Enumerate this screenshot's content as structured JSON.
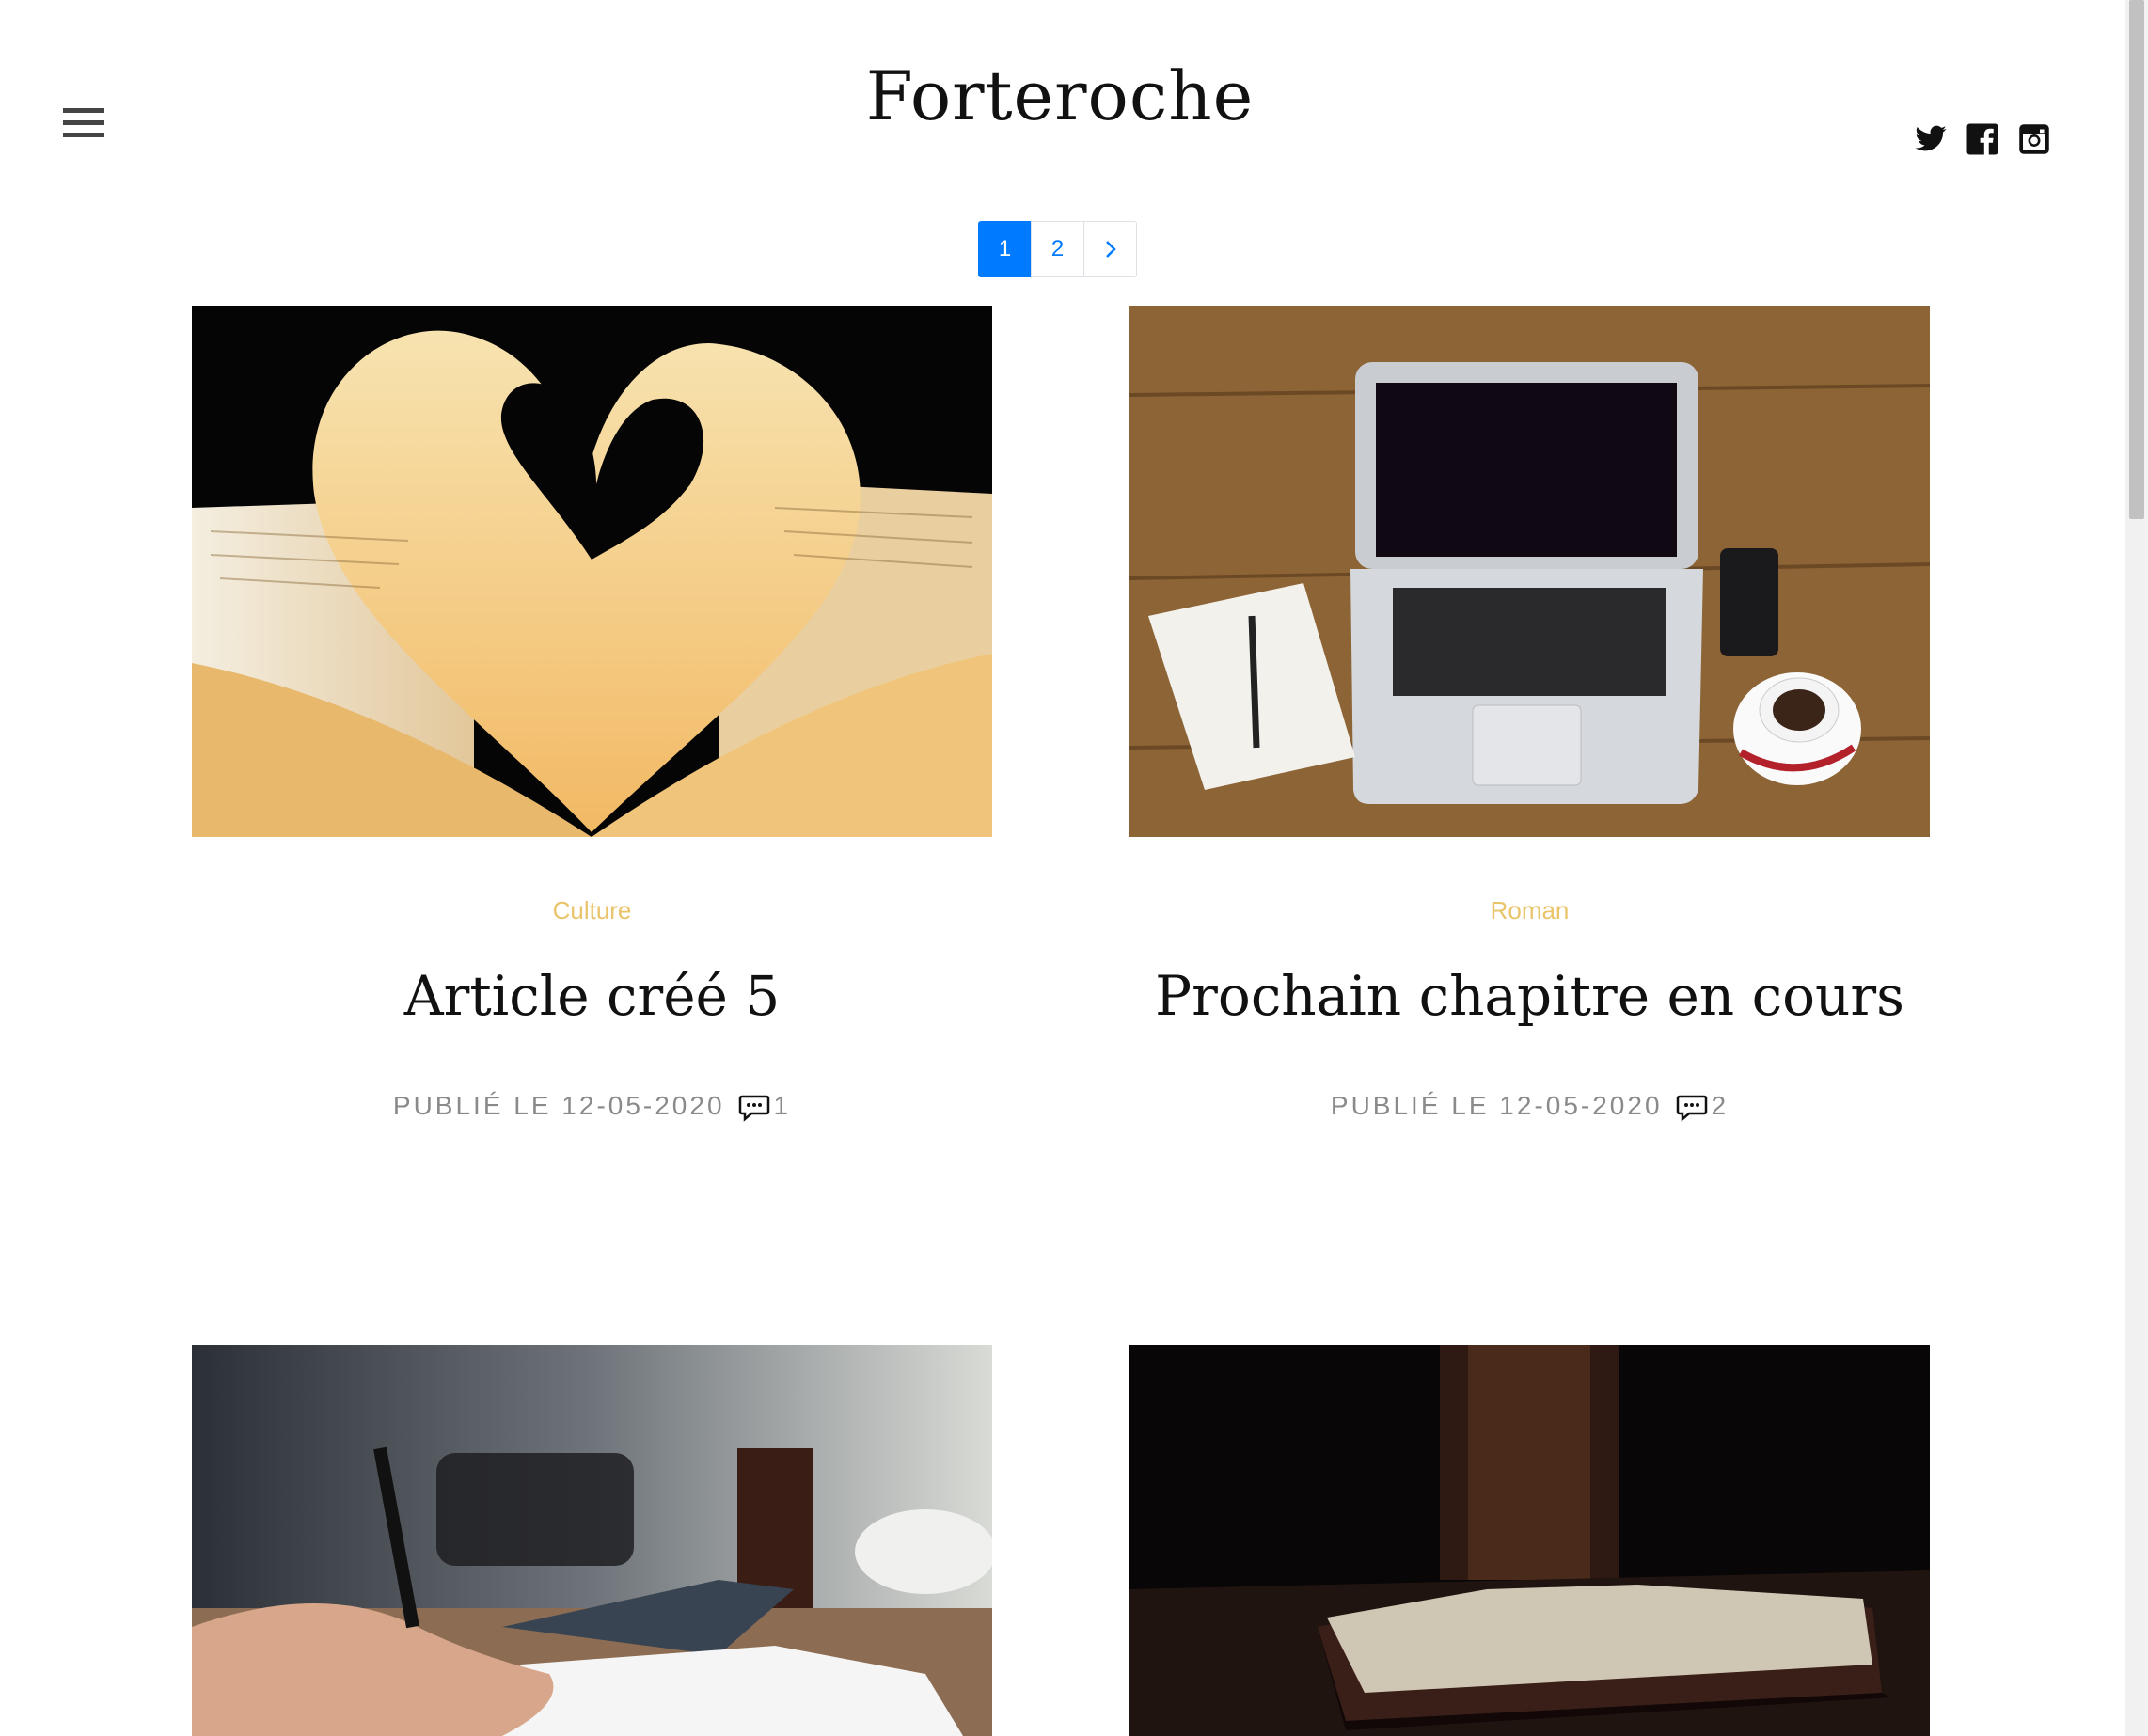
{
  "header": {
    "title": "Forteroche"
  },
  "social": {
    "twitter": "twitter-icon",
    "facebook": "facebook-icon",
    "instagram": "instagram-icon"
  },
  "pagination": {
    "pages": [
      "1",
      "2"
    ],
    "current": "1",
    "next": "›"
  },
  "articles": [
    {
      "category": "Culture",
      "title": "Article créé 5",
      "published": "PUBLIÉ LE 12-05-2020",
      "comments": "1",
      "image": "book-heart-photo"
    },
    {
      "category": "Roman",
      "title": "Prochain chapitre en cours",
      "published": "PUBLIÉ LE 12-05-2020",
      "comments": "2",
      "image": "laptop-desk-photo"
    },
    {
      "image": "writing-notebook-photo"
    },
    {
      "image": "open-book-dark-photo"
    }
  ],
  "colors": {
    "accent": "#007bff",
    "category": "#e9c46a",
    "meta": "#8a8a8a"
  }
}
